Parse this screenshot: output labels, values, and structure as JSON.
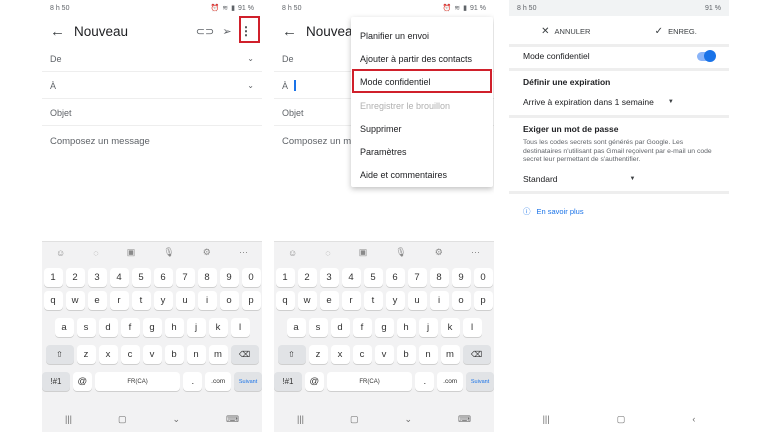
{
  "status": {
    "time": "8 h 50",
    "battery": "91 %"
  },
  "panel1": {
    "title": "Nouveau",
    "fields": {
      "from": "De",
      "to": "À",
      "subject": "Objet"
    },
    "compose_placeholder": "Composez un message"
  },
  "panel2": {
    "title": "Nouveau",
    "fields": {
      "from": "De",
      "to": "À",
      "subject": "Objet"
    },
    "compose_placeholder": "Composez un message",
    "menu": [
      {
        "label": "Planifier un envoi",
        "disabled": false
      },
      {
        "label": "Ajouter à partir des contacts",
        "disabled": false
      },
      {
        "label": "Mode confidentiel",
        "disabled": false,
        "highlighted": true
      },
      {
        "label": "Enregistrer le brouillon",
        "disabled": true
      },
      {
        "label": "Supprimer",
        "disabled": false
      },
      {
        "label": "Paramètres",
        "disabled": false
      },
      {
        "label": "Aide et commentaires",
        "disabled": false
      }
    ]
  },
  "keyboard": {
    "rows": [
      [
        "1",
        "2",
        "3",
        "4",
        "5",
        "6",
        "7",
        "8",
        "9",
        "0"
      ],
      [
        "q",
        "w",
        "e",
        "r",
        "t",
        "y",
        "u",
        "i",
        "o",
        "p"
      ],
      [
        "a",
        "s",
        "d",
        "f",
        "g",
        "h",
        "j",
        "k",
        "l"
      ],
      [
        "z",
        "x",
        "c",
        "v",
        "b",
        "n",
        "m"
      ]
    ],
    "symbols": "!#1",
    "at": "@",
    "space": "FR(CA)",
    "period": ".",
    "com": ".com",
    "next": "Suivant"
  },
  "panel3": {
    "cancel": "ANNULER",
    "save": "ENREG.",
    "confidential_mode": "Mode confidentiel",
    "expiration_heading": "Définir une expiration",
    "expiration_value": "Arrive à expiration dans 1 semaine",
    "password_heading": "Exiger un mot de passe",
    "password_desc": "Tous les codes secrets sont générés par Google. Les destinataires n'utilisant pas Gmail reçoivent par e-mail un code secret leur permettant de s'authentifier.",
    "password_value": "Standard",
    "learn_more": "En savoir plus"
  },
  "colors": {
    "highlight": "#d0202b",
    "accent": "#1a73e8"
  }
}
